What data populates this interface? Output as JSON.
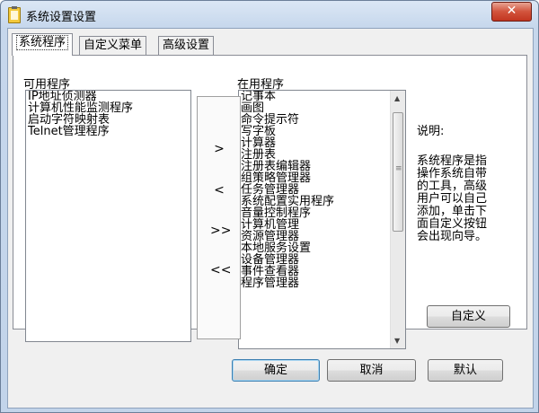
{
  "window": {
    "title": "系统设置设置",
    "close_glyph": "✕"
  },
  "tabs": [
    {
      "label": "系统程序",
      "active": true
    },
    {
      "label": "自定义菜单",
      "active": false
    },
    {
      "label": "高级设置",
      "active": false
    }
  ],
  "available": {
    "label": "可用程序",
    "items": [
      "IP地址侦测器",
      "计算机性能监测程序",
      "启动字符映射表",
      "Telnet管理程序"
    ]
  },
  "in_use": {
    "label": "在用程序",
    "items": [
      "记事本",
      "画图",
      "命令提示符",
      "写字板",
      "计算器",
      "注册表",
      "注册表编辑器",
      "组策略管理器",
      "任务管理器",
      "系统配置实用程序",
      "音量控制程序",
      "计算机管理",
      "资源管理器",
      "本地服务设置",
      "设备管理器",
      "事件查看器",
      "程序管理器"
    ]
  },
  "move_buttons": {
    "add": ">",
    "remove": "<",
    "add_all": ">>",
    "remove_all": "<<"
  },
  "description": {
    "title": "说明:",
    "lines": [
      "系统程序是指",
      "操作系统自带",
      "的工具，高级",
      "用户可以自己",
      "添加，单击下",
      "面自定义按钮",
      "会出现向导。"
    ]
  },
  "buttons": {
    "customize": "自定义",
    "ok": "确定",
    "cancel": "取消",
    "default": "默认"
  },
  "colors": {
    "close_red": "#c23520",
    "dialog_bg": "#f0f0f0"
  }
}
